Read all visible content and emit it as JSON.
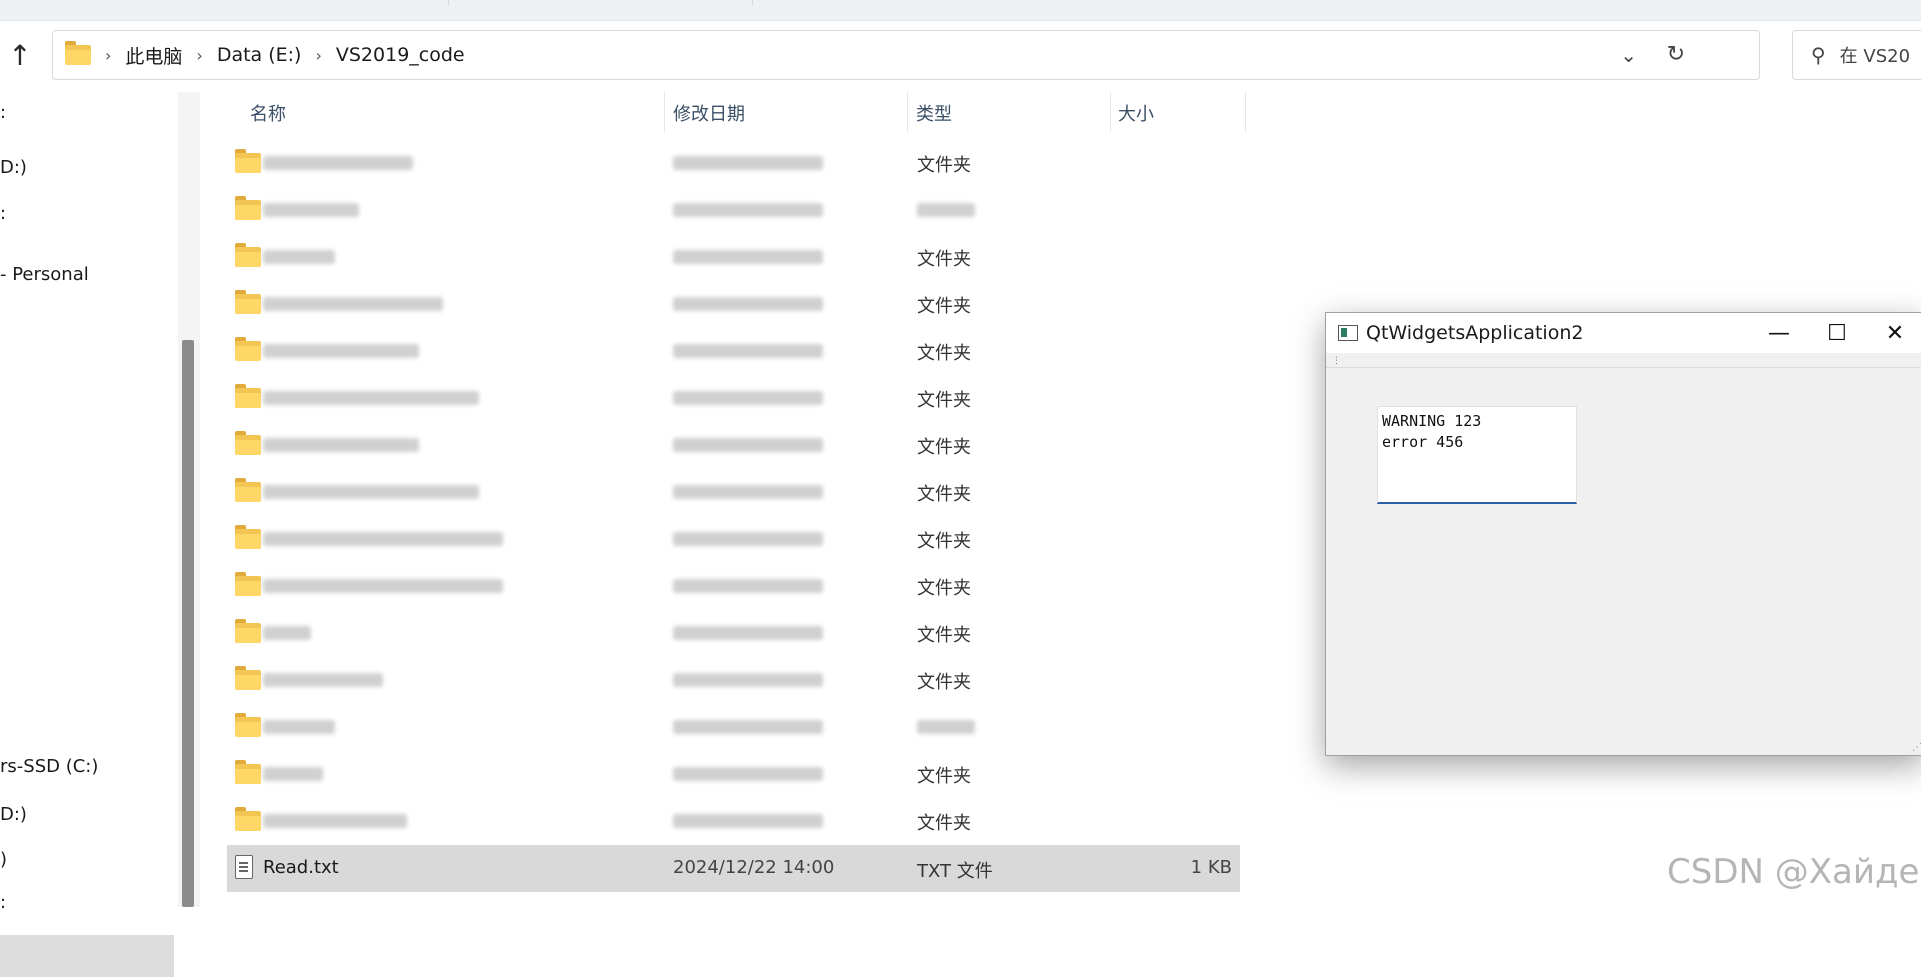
{
  "address_bar": {
    "crumbs": [
      "此电脑",
      "Data (E:)",
      "VS2019_code"
    ],
    "dropdown_icon": "chevron-down-icon",
    "refresh_icon": "refresh-icon"
  },
  "search": {
    "placeholder": "在 VS20"
  },
  "nav": {
    "items": [
      ":",
      "D:)",
      ":",
      "- Personal",
      "rs-SSD (C:)",
      "D:)",
      ")",
      ":"
    ]
  },
  "columns": {
    "name": "名称",
    "modified": "修改日期",
    "type": "类型",
    "size": "大小"
  },
  "rows": [
    {
      "type": "文件夹"
    },
    {
      "type": ""
    },
    {
      "type": "文件夹"
    },
    {
      "type": "文件夹"
    },
    {
      "type": "文件夹"
    },
    {
      "type": "文件夹"
    },
    {
      "type": "文件夹"
    },
    {
      "type": "文件夹"
    },
    {
      "type": "文件夹"
    },
    {
      "type": "文件夹"
    },
    {
      "type": "文件夹"
    },
    {
      "type": "文件夹"
    },
    {
      "type": ""
    },
    {
      "type": "文件夹"
    },
    {
      "type": "文件夹"
    }
  ],
  "selected_file": {
    "name": "Read.txt",
    "modified": "2024/12/22 14:00",
    "type": "TXT 文件",
    "size": "1 KB"
  },
  "qt_window": {
    "title": "QtWidgetsApplication2",
    "text_lines": [
      "WARNING 123",
      "error 456"
    ],
    "controls": {
      "minimize": "—",
      "maximize": "☐",
      "close": "✕"
    }
  },
  "watermark": "CSDN @Хайде"
}
